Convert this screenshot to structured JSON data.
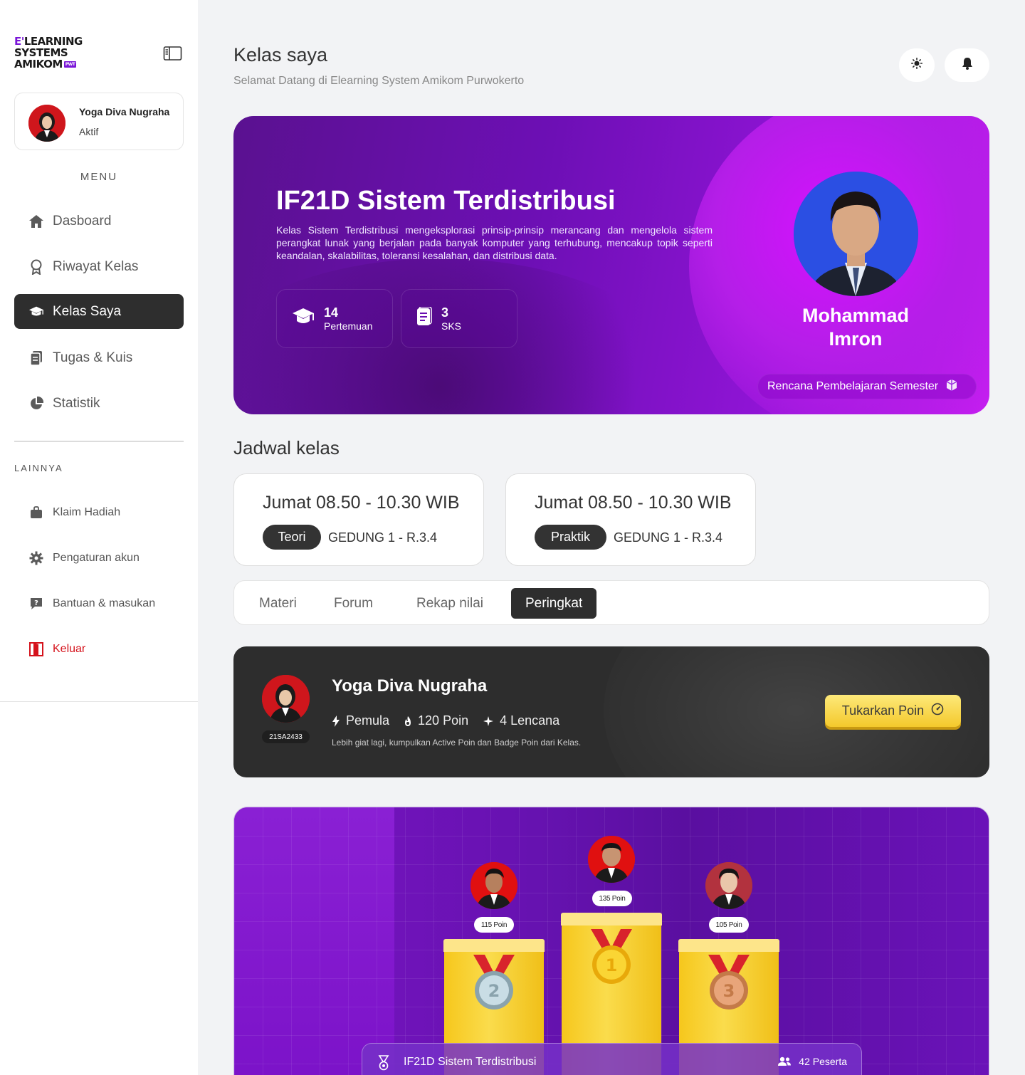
{
  "brand": {
    "logo_line1_accent": "E'",
    "logo_line1": "LEARNING",
    "logo_line2": "SYSTEMS",
    "logo_line3": "AMIKOM",
    "logo_tag": "PWT",
    "accent_color": "#7a16d8"
  },
  "user": {
    "name": "Yoga Diva Nugraha",
    "status": "Aktif",
    "nim": "21SA2433"
  },
  "sidebar": {
    "menu_title": "MENU",
    "items": [
      {
        "label": "Dasboard",
        "icon": "home-icon"
      },
      {
        "label": "Riwayat Kelas",
        "icon": "award-icon"
      },
      {
        "label": "Kelas Saya",
        "icon": "graduation-cap-icon",
        "active": true
      },
      {
        "label": "Tugas & Kuis",
        "icon": "documents-icon"
      },
      {
        "label": "Statistik",
        "icon": "pie-chart-icon"
      }
    ],
    "other_title": "LAINNYA",
    "other_items": [
      {
        "label": "Klaim Hadiah",
        "icon": "bag-icon"
      },
      {
        "label": "Pengaturan akun",
        "icon": "gear-icon"
      },
      {
        "label": "Bantuan & masukan",
        "icon": "help-chat-icon"
      },
      {
        "label": "Keluar",
        "icon": "logout-door-icon",
        "color": "#d5121b"
      }
    ]
  },
  "header": {
    "title": "Kelas saya",
    "subtitle": "Selamat Datang di Elearning System Amikom Purwokerto"
  },
  "course": {
    "title": "IF21D Sistem Terdistribusi",
    "description": "Kelas Sistem Terdistribusi mengeksplorasi prinsip-prinsip merancang dan mengelola sistem perangkat lunak yang berjalan pada banyak komputer yang terhubung, mencakup topik seperti keandalan, skalabilitas, toleransi kesalahan, dan distribusi data.",
    "meetings_count": "14",
    "meetings_label": "Pertemuan",
    "sks_count": "3",
    "sks_label": "SKS",
    "lecturer_first": "Mohammad",
    "lecturer_last": "Imron",
    "rps_label": "Rencana Pembelajaran Semester"
  },
  "schedule": {
    "title": "Jadwal kelas",
    "items": [
      {
        "time": "Jumat 08.50 - 10.30 WIB",
        "type": "Teori",
        "room": "GEDUNG 1 - R.3.4"
      },
      {
        "time": "Jumat 08.50 - 10.30 WIB",
        "type": "Praktik",
        "room": "GEDUNG 1 - R.3.4"
      }
    ]
  },
  "tabs": [
    {
      "label": "Materi"
    },
    {
      "label": "Forum"
    },
    {
      "label": "Rekap nilai"
    },
    {
      "label": "Peringkat",
      "active": true
    }
  ],
  "points_card": {
    "name": "Yoga Diva Nugraha",
    "level": "Pemula",
    "points": "120 Poin",
    "badges": "4 Lencana",
    "note": "Lebih giat lagi, kumpulkan Active Poin dan Badge Poin dari Kelas.",
    "button": "Tukarkan Poin"
  },
  "leaderboard": {
    "first_points": "135 Poin",
    "second_points": "115 Poin",
    "third_points": "105 Poin",
    "first_rank": "1",
    "second_rank": "2",
    "third_rank": "3",
    "class_name": "IF21D Sistem Terdistribusi",
    "participants": "42 Peserta"
  }
}
